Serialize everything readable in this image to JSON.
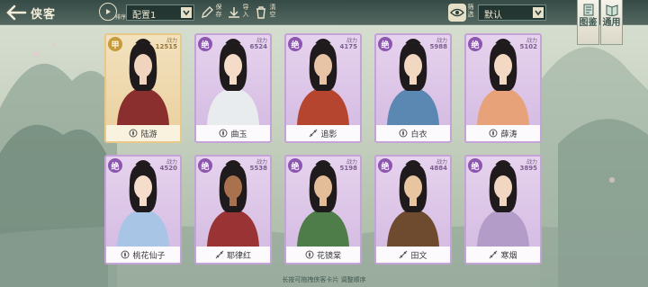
{
  "header": {
    "title": "侠客",
    "sort_label": "排序",
    "config_select": "配置1",
    "save_label": "保存",
    "import_label": "导入",
    "clear_label": "清空",
    "filter_label": "筛选",
    "filter_select": "默认"
  },
  "side_buttons": [
    {
      "label": "图鉴"
    },
    {
      "label": "通用"
    }
  ],
  "cards": [
    {
      "name": "陆游",
      "grade": "甲",
      "power_label": "战力",
      "power": "12515",
      "rarity": "gold",
      "cls": "lotus"
    },
    {
      "name": "曲玉",
      "grade": "绝",
      "power_label": "战力",
      "power": "6524",
      "rarity": "purple",
      "cls": "lotus"
    },
    {
      "name": "追影",
      "grade": "绝",
      "power_label": "战力",
      "power": "4175",
      "rarity": "purple",
      "cls": "blade"
    },
    {
      "name": "白衣",
      "grade": "绝",
      "power_label": "战力",
      "power": "5988",
      "rarity": "purple",
      "cls": "lotus"
    },
    {
      "name": "薛涛",
      "grade": "绝",
      "power_label": "战力",
      "power": "5102",
      "rarity": "purple",
      "cls": "lotus"
    },
    {
      "name": "桃花仙子",
      "grade": "绝",
      "power_label": "战力",
      "power": "4520",
      "rarity": "purple",
      "cls": "lotus"
    },
    {
      "name": "耶律红",
      "grade": "绝",
      "power_label": "战力",
      "power": "5538",
      "rarity": "purple",
      "cls": "blade"
    },
    {
      "name": "花镜棠",
      "grade": "绝",
      "power_label": "战力",
      "power": "5198",
      "rarity": "purple",
      "cls": "lotus"
    },
    {
      "name": "田文",
      "grade": "绝",
      "power_label": "战力",
      "power": "4884",
      "rarity": "purple",
      "cls": "blade"
    },
    {
      "name": "寒烟",
      "grade": "绝",
      "power_label": "战力",
      "power": "3895",
      "rarity": "purple",
      "cls": "blade"
    }
  ],
  "hint": "长按可拖拽侠客卡片 调整顺序"
}
